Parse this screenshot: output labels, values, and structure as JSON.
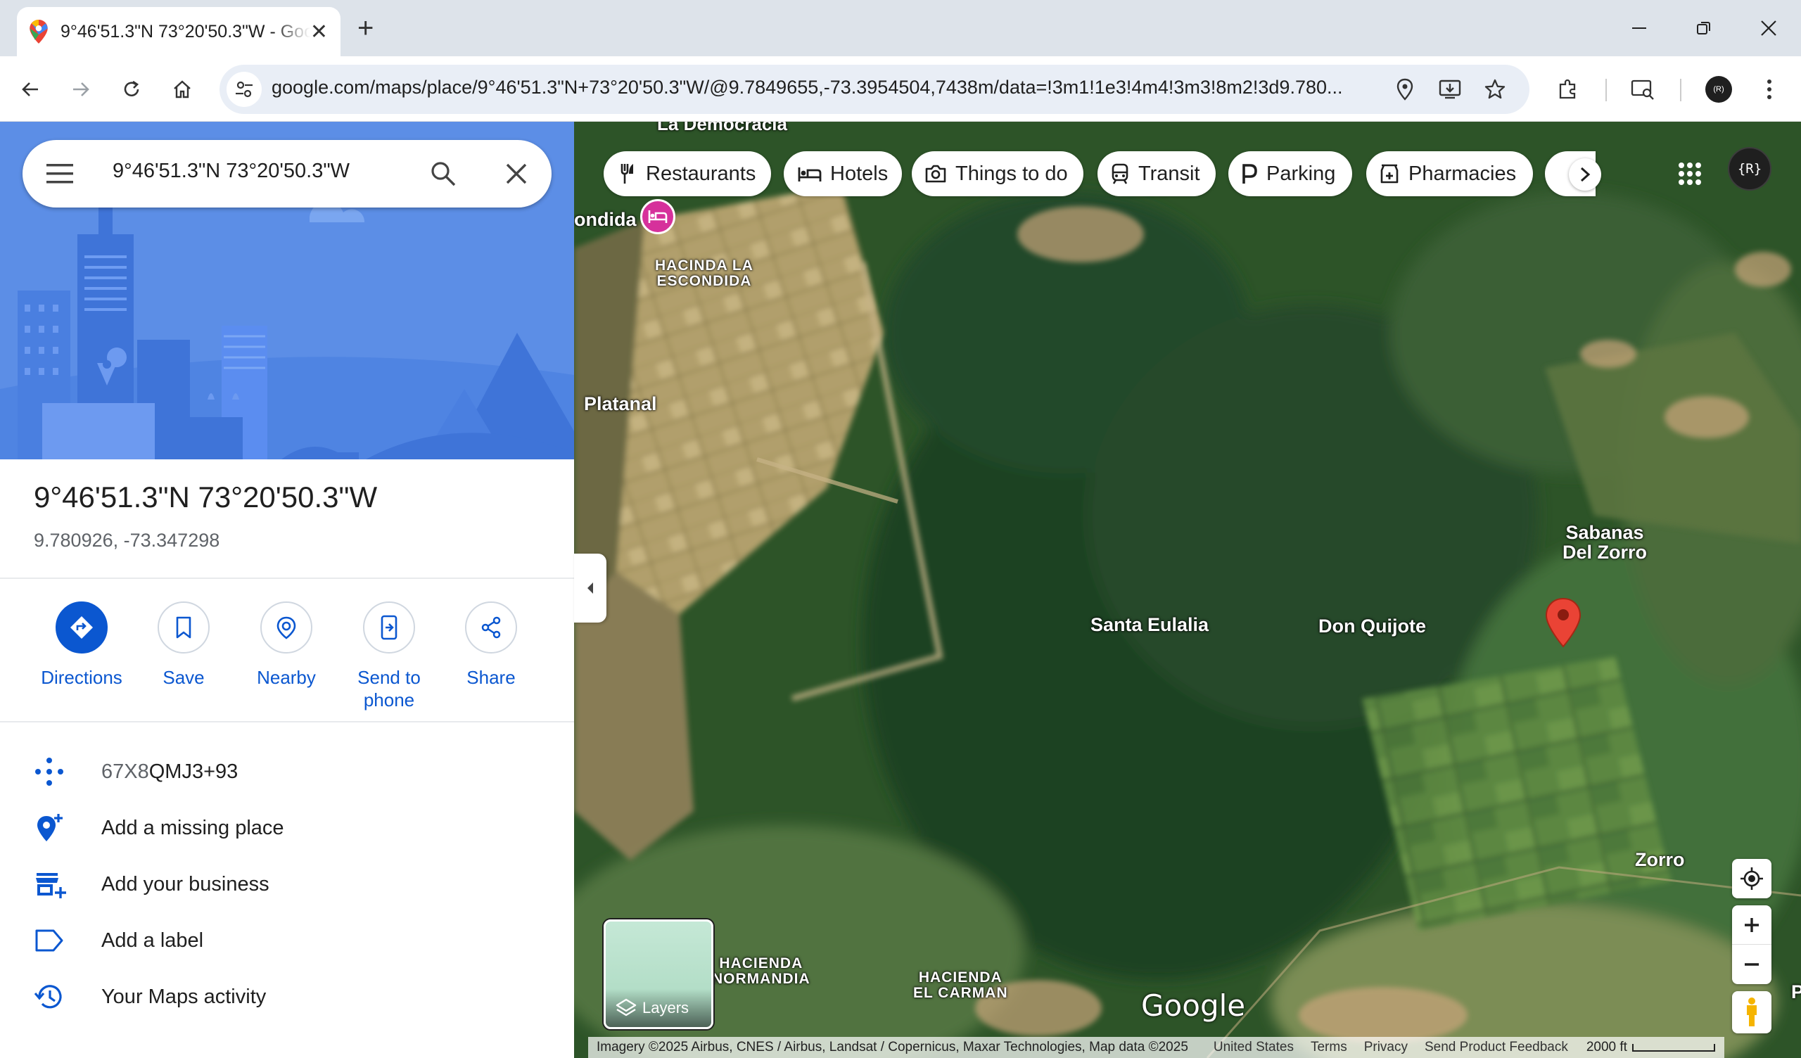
{
  "browser": {
    "tab_title": "9°46'51.3\"N 73°20'50.3\"W - Google Maps",
    "url": "google.com/maps/place/9°46'51.3\"N+73°20'50.3\"W/@9.7849655,-73.3954504,7438m/data=!3m1!1e3!4m4!3m3!8m2!3d9.780..."
  },
  "search": {
    "query": "9°46'51.3\"N 73°20'50.3\"W"
  },
  "place": {
    "title": "9°46'51.3\"N 73°20'50.3\"W",
    "coords": "9.780926, -73.347298"
  },
  "actions": [
    {
      "label": "Directions"
    },
    {
      "label": "Save"
    },
    {
      "label": "Nearby"
    },
    {
      "label": "Send to phone"
    },
    {
      "label": "Share"
    }
  ],
  "details": {
    "plus_code_prefix": "67X8",
    "plus_code_rest": "QMJ3+93",
    "add_missing_place": "Add a missing place",
    "add_business": "Add your business",
    "add_label": "Add a label",
    "maps_activity": "Your Maps activity"
  },
  "chips": [
    {
      "label": "Restaurants",
      "icon": "restaurant-icon"
    },
    {
      "label": "Hotels",
      "icon": "hotel-icon"
    },
    {
      "label": "Things to do",
      "icon": "camera-icon"
    },
    {
      "label": "Transit",
      "icon": "transit-icon"
    },
    {
      "label": "Parking",
      "icon": "parking-icon"
    },
    {
      "label": "Pharmacies",
      "icon": "pharmacy-icon"
    }
  ],
  "account_initial": "{R}",
  "map_labels": {
    "la_democracia": "La Democracia",
    "escondida": "ondida",
    "hacienda_escondida_1": "HACINDA LA",
    "hacienda_escondida_2": "ESCONDIDA",
    "platanal": "Platanal",
    "sabanas_1": "Sabanas",
    "sabanas_2": "Del Zorro",
    "santa_eulalia": "Santa Eulalia",
    "don_quijote": "Don Quijote",
    "zorro": "Zorro",
    "hacienda_normandia_1": "HACIENDA",
    "hacienda_normandia_2": "NORMANDIA",
    "hacienda_carmen_1": "HACIENDA",
    "hacienda_carmen_2": "EL CARMAN",
    "edge_p": "P",
    "google": "Google"
  },
  "layers_label": "Layers",
  "attribution": {
    "imagery": "Imagery ©2025 Airbus, CNES / Airbus, Landsat / Copernicus, Maxar Technologies, Map data ©2025",
    "country": "United States",
    "terms": "Terms",
    "privacy": "Privacy",
    "feedback": "Send Product Feedback",
    "scale": "2000 ft"
  },
  "colors": {
    "accent": "#0b57d0",
    "pin": "#ea4335",
    "hero": "#5c8ee6"
  }
}
